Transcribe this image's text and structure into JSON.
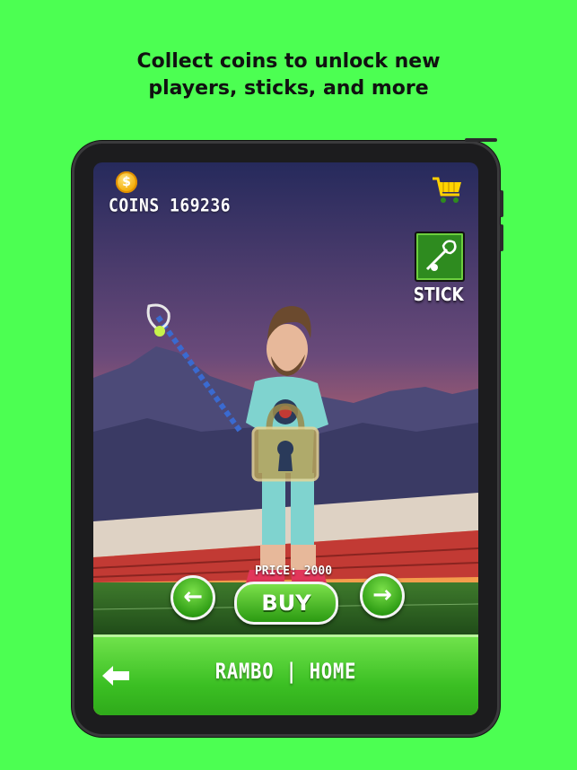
{
  "headline": {
    "line1": "Collect coins to unlock new",
    "line2": "players, sticks, and more"
  },
  "hud": {
    "coin_glyph": "$",
    "coins_label": "COINS 169236",
    "cart_icon": "shopping-cart-icon"
  },
  "stick_button": {
    "icon": "lacrosse-stick-icon",
    "label": "STICK"
  },
  "shop": {
    "price_label": "PRICE: 2000",
    "prev_label": "←",
    "next_label": "→",
    "buy_label": "BUY",
    "lock_icon": "padlock-icon"
  },
  "bottom_bar": {
    "back_icon": "back-arrow-icon",
    "title": "RAMBO | HOME"
  },
  "colors": {
    "page_bg": "#4cff52",
    "button_green": "#3bbf23",
    "sky_top": "#2a2a5a",
    "sky_bottom": "#f08a3c"
  }
}
